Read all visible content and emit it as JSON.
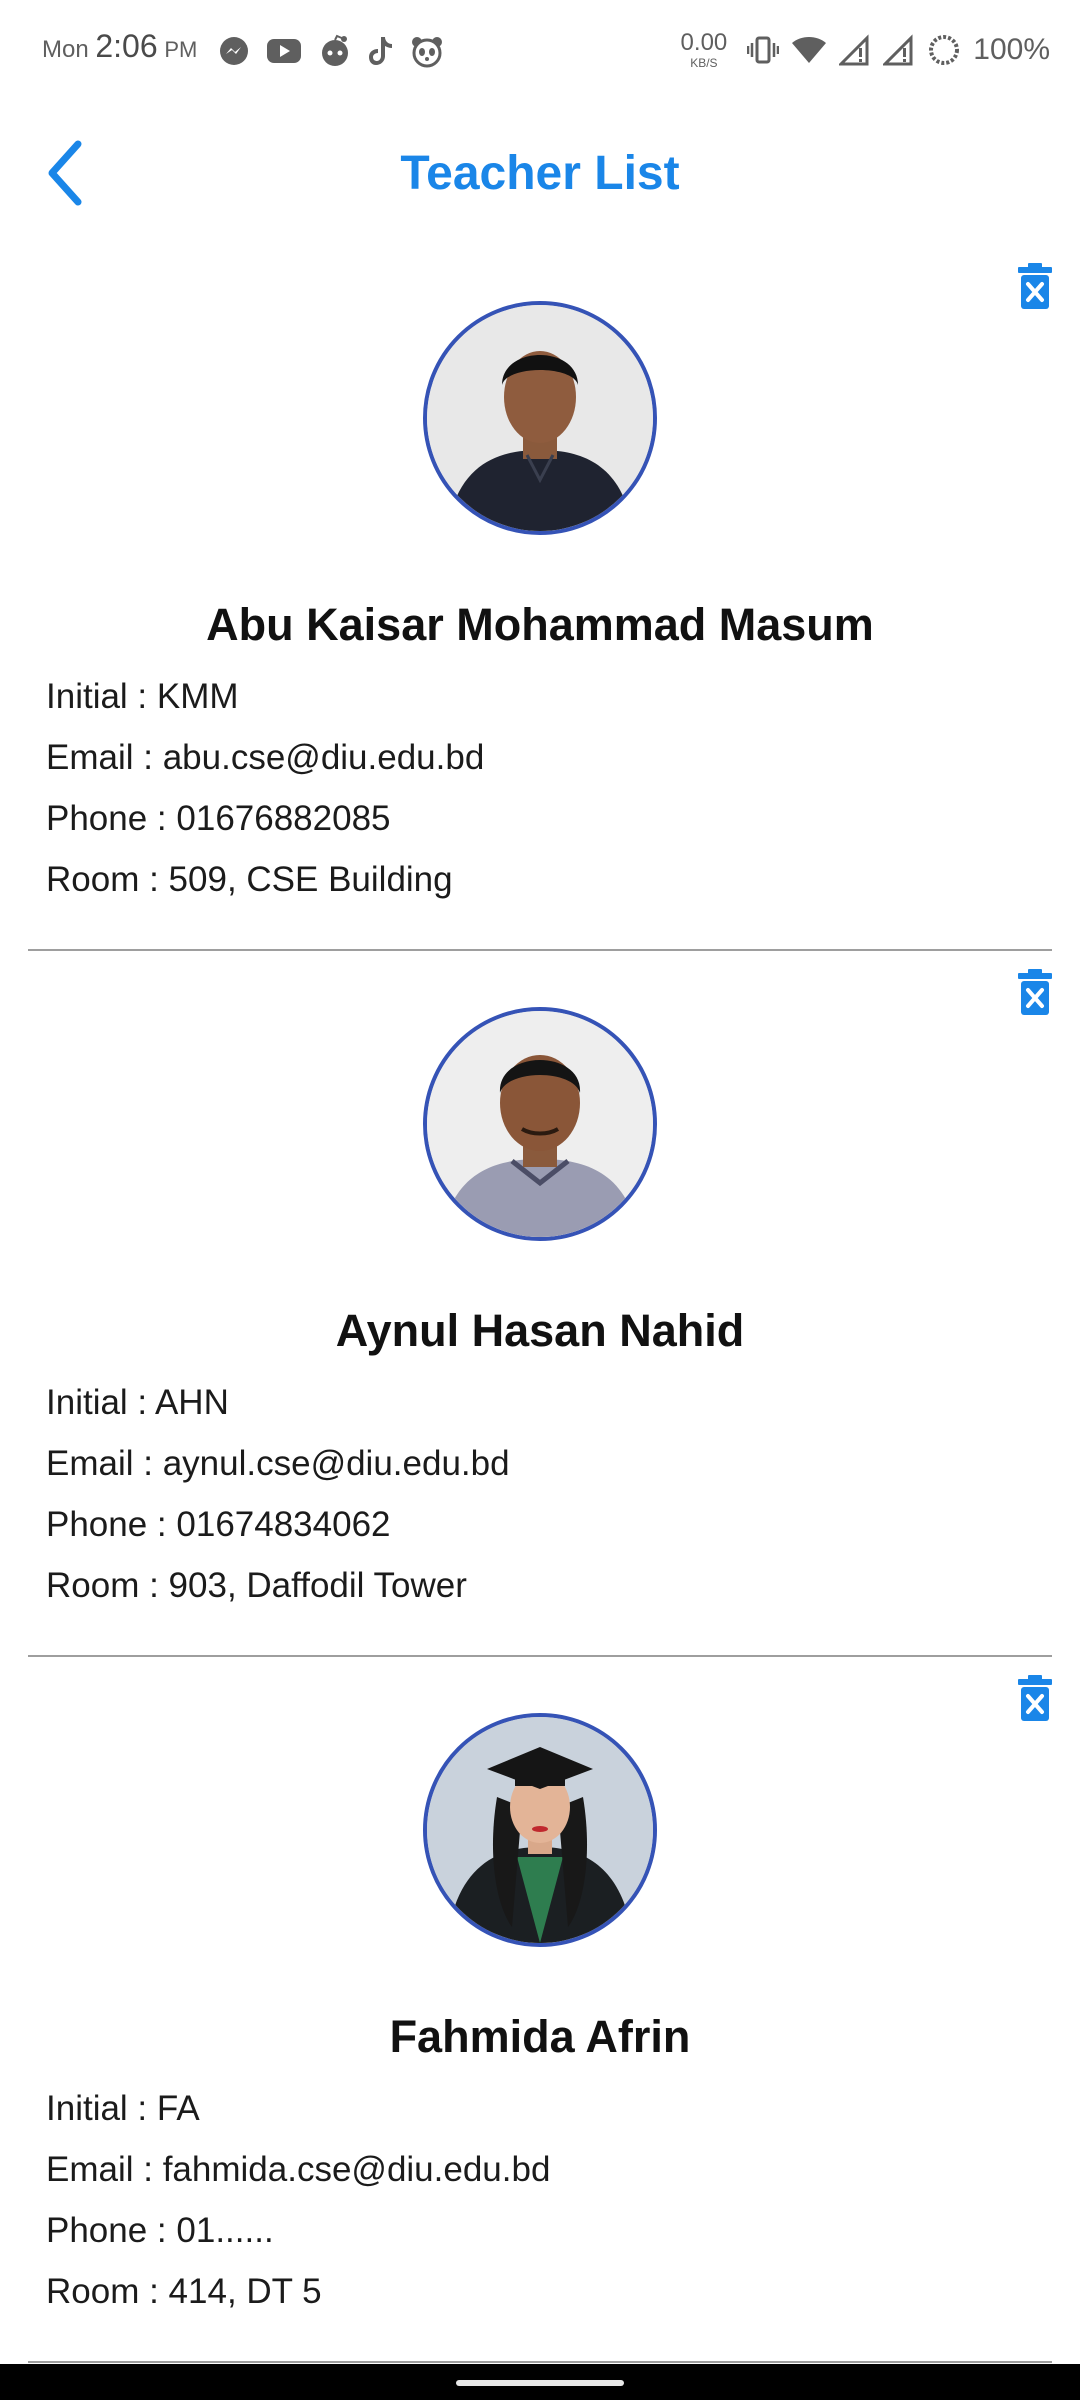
{
  "status_bar": {
    "day": "Mon",
    "time": "2:06",
    "ampm": "PM",
    "net_speed_value": "0.00",
    "net_speed_unit": "KB/S",
    "battery": "100%",
    "left_icons": [
      "messenger-icon",
      "youtube-icon",
      "reddit-icon",
      "tiktok-icon",
      "panda-icon"
    ],
    "right_icons": [
      "vibrate-icon",
      "wifi-icon",
      "signal-icon",
      "signal-icon",
      "battery-icon"
    ]
  },
  "app_bar": {
    "title": "Teacher List",
    "back_icon": "chevron-left-icon",
    "accent_color": "#1a86e8"
  },
  "teachers": [
    {
      "name": "Abu Kaisar Mohammad Masum",
      "initial_label": "Initial : ",
      "initial": "KMM",
      "email_label": "Email : ",
      "email": "abu.cse@diu.edu.bd",
      "phone_label": "Phone : ",
      "phone": "01676882085",
      "room_label": "Room : ",
      "room": "509, CSE Building"
    },
    {
      "name": "Aynul Hasan Nahid",
      "initial_label": "Initial : ",
      "initial": "AHN",
      "email_label": "Email : ",
      "email": "aynul.cse@diu.edu.bd",
      "phone_label": "Phone : ",
      "phone": "01674834062",
      "room_label": "Room : ",
      "room": "903, Daffodil Tower"
    },
    {
      "name": "Fahmida Afrin",
      "initial_label": "Initial : ",
      "initial": "FA",
      "email_label": "Email : ",
      "email": "fahmida.cse@diu.edu.bd",
      "phone_label": "Phone : ",
      "phone": "01......",
      "room_label": "Room : ",
      "room": "414, DT 5"
    }
  ],
  "colors": {
    "delete_icon": "#1a86e8",
    "avatar_border": "#3553b6",
    "divider": "#9e9e9e"
  }
}
